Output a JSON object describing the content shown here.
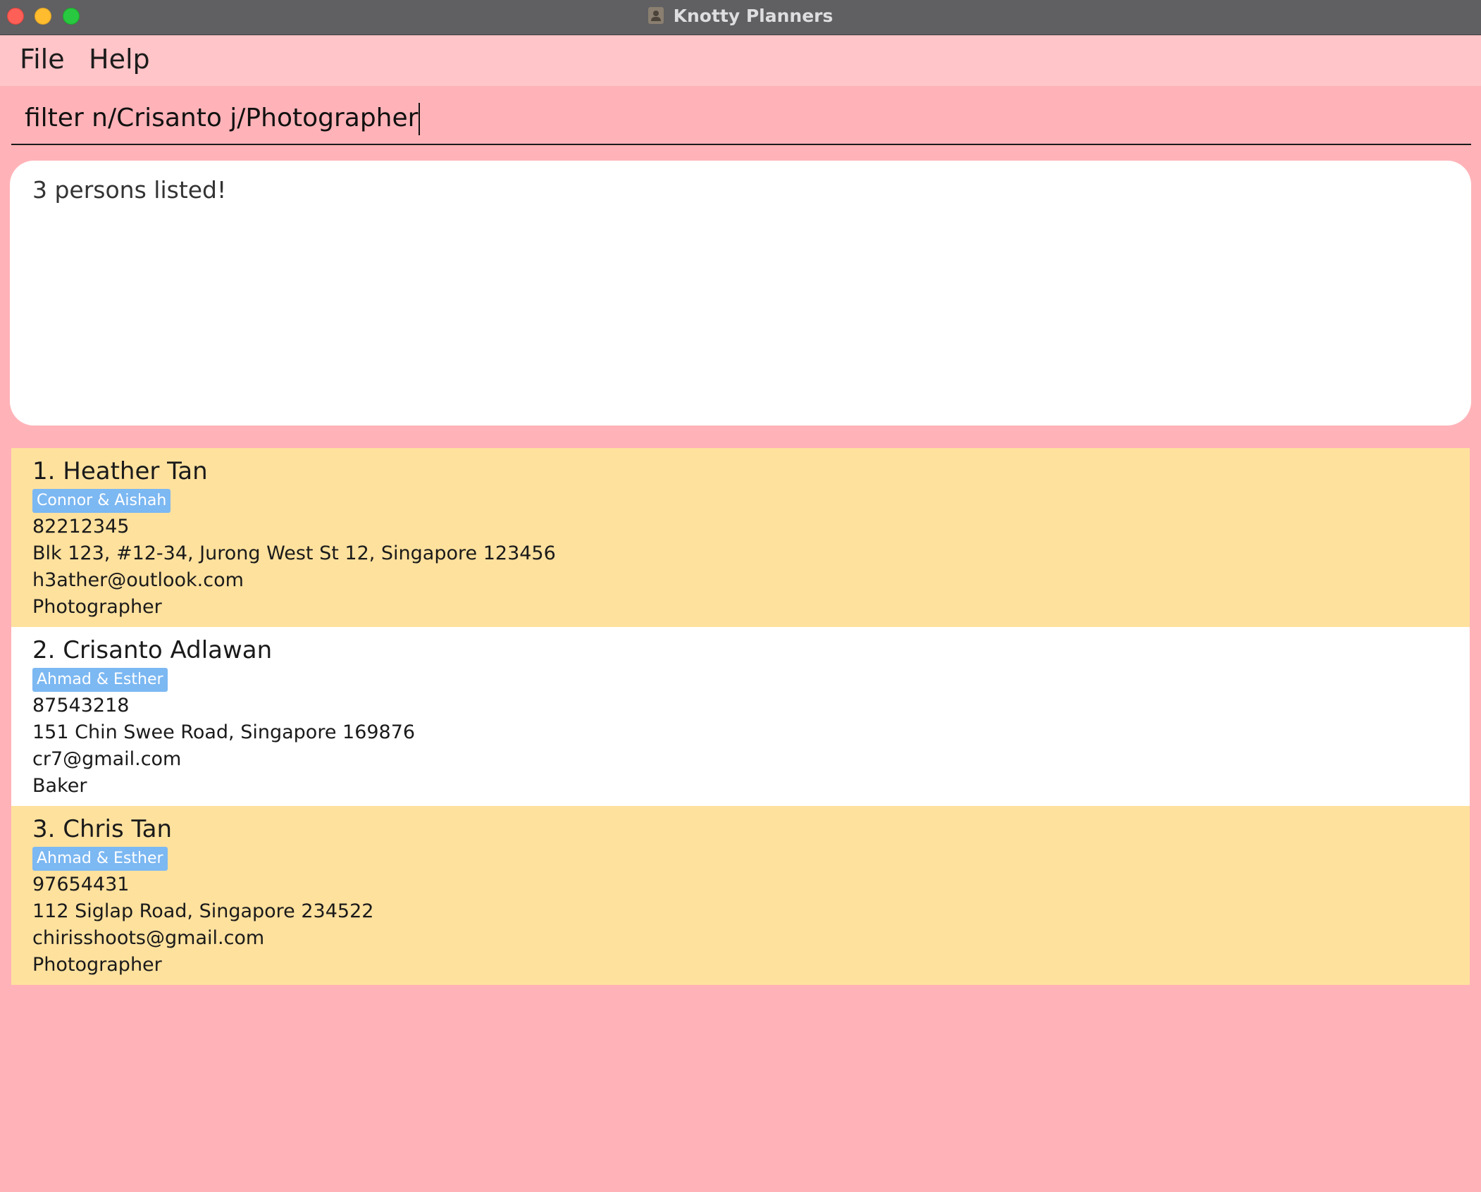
{
  "window": {
    "title": "Knotty Planners",
    "app_icon": "contacts-icon"
  },
  "menu": {
    "file": "File",
    "help": "Help"
  },
  "command": {
    "value": "filter n/Crisanto j/Photographer"
  },
  "result": {
    "message": "3 persons listed!"
  },
  "persons": [
    {
      "name": "1. Heather Tan",
      "tag": "Connor & Aishah",
      "phone": "82212345",
      "address": "Blk 123, #12-34, Jurong West St 12, Singapore 123456",
      "email": "h3ather@outlook.com",
      "job": "Photographer"
    },
    {
      "name": "2. Crisanto Adlawan",
      "tag": "Ahmad & Esther",
      "phone": "87543218",
      "address": "151 Chin Swee Road, Singapore 169876",
      "email": "cr7@gmail.com",
      "job": "Baker"
    },
    {
      "name": "3. Chris Tan",
      "tag": "Ahmad & Esther",
      "phone": "97654431",
      "address": "112 Siglap Road, Singapore 234522",
      "email": "chirisshoots@gmail.com",
      "job": "Photographer"
    }
  ],
  "colors": {
    "background": "#ffb3b8",
    "menubar": "#ffc5c8",
    "card_highlight": "#ffe19e",
    "card_plain": "#ffffff",
    "tag": "#7cb8f2"
  }
}
